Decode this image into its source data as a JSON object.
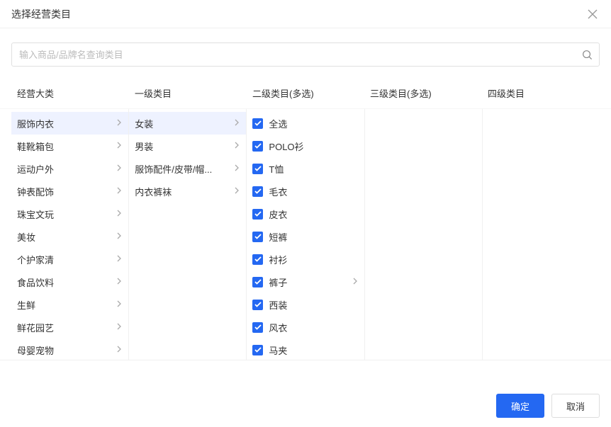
{
  "dialog": {
    "title": "选择经营类目"
  },
  "search": {
    "placeholder": "输入商品/品牌名查询类目"
  },
  "headers": {
    "c1": "经营大类",
    "c2": "一级类目",
    "c3": "二级类目(多选)",
    "c4": "三级类目(多选)",
    "c5": "四级类目"
  },
  "col1": [
    {
      "label": "服饰内衣",
      "selected": true
    },
    {
      "label": "鞋靴箱包"
    },
    {
      "label": "运动户外"
    },
    {
      "label": "钟表配饰"
    },
    {
      "label": "珠宝文玩"
    },
    {
      "label": "美妆"
    },
    {
      "label": "个护家清"
    },
    {
      "label": "食品饮料"
    },
    {
      "label": "生鲜"
    },
    {
      "label": "鲜花园艺"
    },
    {
      "label": "母婴宠物"
    }
  ],
  "col2": [
    {
      "label": "女装",
      "selected": true
    },
    {
      "label": "男装"
    },
    {
      "label": "服饰配件/皮带/帽..."
    },
    {
      "label": "内衣裤袜"
    }
  ],
  "col3": [
    {
      "label": "全选",
      "checked": true
    },
    {
      "label": "POLO衫",
      "checked": true
    },
    {
      "label": "T恤",
      "checked": true
    },
    {
      "label": "毛衣",
      "checked": true
    },
    {
      "label": "皮衣",
      "checked": true
    },
    {
      "label": "短裤",
      "checked": true
    },
    {
      "label": "衬衫",
      "checked": true
    },
    {
      "label": "裤子",
      "checked": true,
      "hasChildren": true
    },
    {
      "label": "西装",
      "checked": true
    },
    {
      "label": "风衣",
      "checked": true
    },
    {
      "label": "马夹",
      "checked": true
    }
  ],
  "footer": {
    "confirm": "确定",
    "cancel": "取消"
  }
}
